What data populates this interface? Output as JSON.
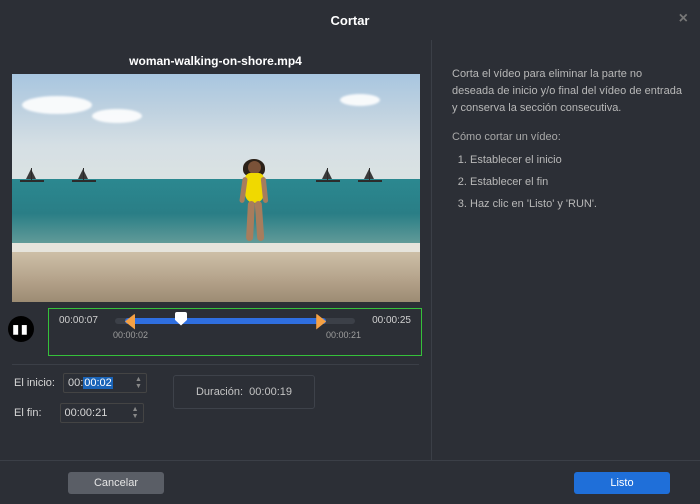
{
  "title": "Cortar",
  "filename": "woman-walking-on-shore.mp4",
  "timeline": {
    "current": "00:00:07",
    "total": "00:00:25",
    "start_label": "00:00:02",
    "end_label": "00:00:21"
  },
  "fields": {
    "start_label": "El inicio:",
    "start_value_prefix": "00:",
    "start_value_sel": "00:02",
    "end_label": "El fin:",
    "end_value": "00:00:21",
    "duration_label": "Duración:",
    "duration_value": "00:00:19"
  },
  "help": {
    "intro": "Corta el vídeo para eliminar la parte no deseada de inicio y/o final del vídeo de entrada y conserva la sección consecutiva.",
    "howto_title": "Cómo cortar un vídeo:",
    "steps": [
      "Establecer el inicio",
      "Establecer el fin",
      "Haz clic en 'Listo' y 'RUN'."
    ]
  },
  "buttons": {
    "cancel": "Cancelar",
    "done": "Listo"
  }
}
